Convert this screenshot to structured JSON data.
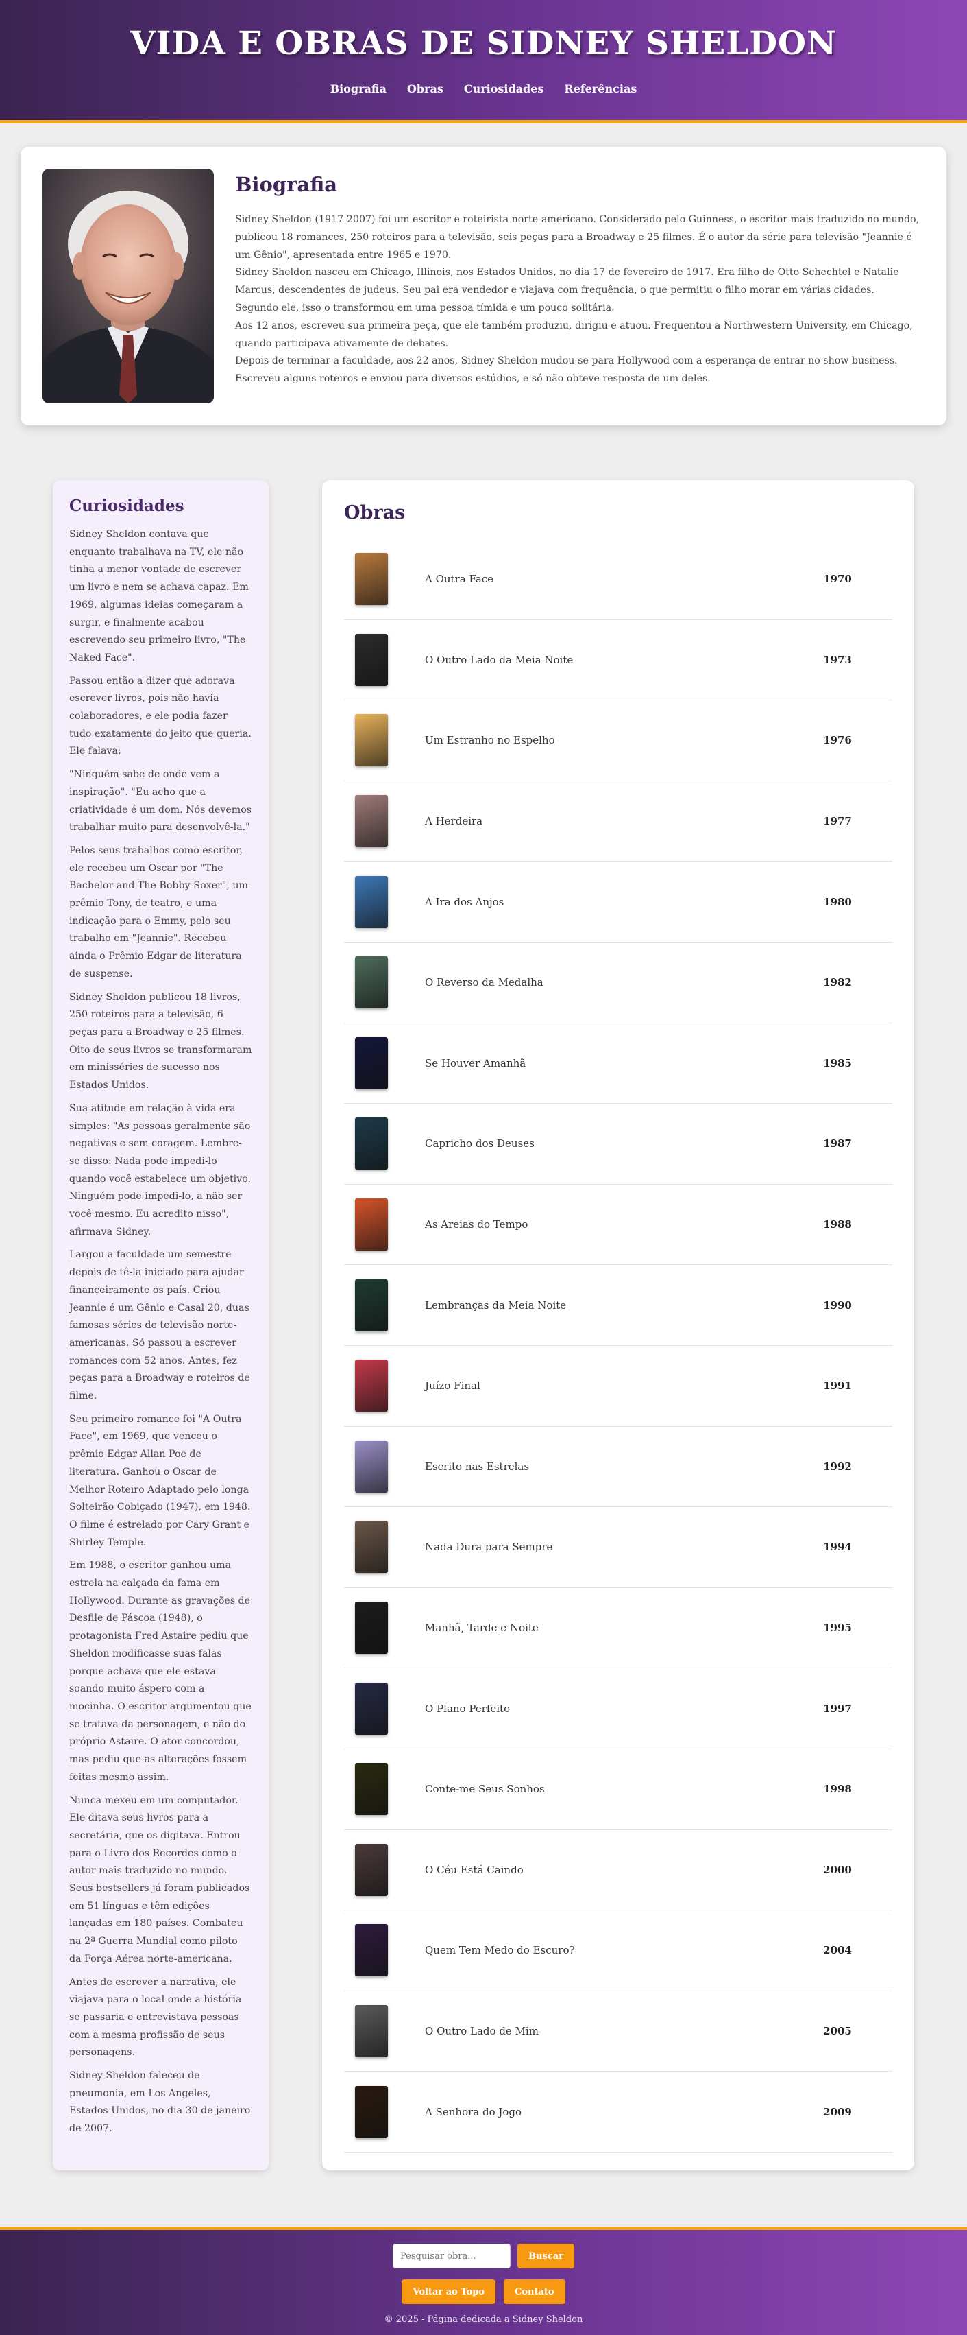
{
  "header": {
    "title": "VIDA E OBRAS DE SIDNEY SHELDON",
    "nav": [
      "Biografia",
      "Obras",
      "Curiosidades",
      "Referências"
    ]
  },
  "biography": {
    "title": "Biografia",
    "portrait_alt": "Sidney Sheldon",
    "paragraphs": [
      "Sidney Sheldon (1917-2007) foi um escritor e roteirista norte-americano. Considerado pelo Guinness, o escritor mais traduzido no mundo, publicou 18 romances, 250 roteiros para a televisão, seis peças para a Broadway e 25 filmes. É o autor da série para televisão \"Jeannie é um Gênio\", apresentada entre 1965 e 1970.",
      "Sidney Sheldon nasceu em Chicago, Illinois, nos Estados Unidos, no dia 17 de fevereiro de 1917. Era filho de Otto Schechtel e Natalie Marcus, descendentes de judeus. Seu pai era vendedor e viajava com frequência, o que permitiu o filho morar em várias cidades. Segundo ele, isso o transformou em uma pessoa tímida e um pouco solitária.",
      "Aos 12 anos, escreveu sua primeira peça, que ele também produziu, dirigiu e atuou. Frequentou a Northwestern University, em Chicago, quando participava ativamente de debates.",
      "Depois de terminar a faculdade, aos 22 anos, Sidney Sheldon mudou-se para Hollywood com a esperança de entrar no show business. Escreveu alguns roteiros e enviou para diversos estúdios, e só não obteve resposta de um deles."
    ]
  },
  "curiosities": {
    "title": "Curiosidades",
    "paragraphs": [
      "Sidney Sheldon contava que enquanto trabalhava na TV, ele não tinha a menor vontade de escrever um livro e nem se achava capaz. Em 1969, algumas ideias começaram a surgir, e finalmente acabou escrevendo seu primeiro livro, \"The Naked Face\".",
      "Passou então a dizer que adorava escrever livros, pois não havia colaboradores, e ele podia fazer tudo exatamente do jeito que queria. Ele falava:",
      "\"Ninguém sabe de onde vem a inspiração\". \"Eu acho que a criatividade é um dom. Nós devemos trabalhar muito para desenvolvê-la.\"",
      "Pelos seus trabalhos como escritor, ele recebeu um Oscar por \"The Bachelor and The Bobby-Soxer\", um prêmio Tony, de teatro, e uma indicação para o Emmy, pelo seu trabalho em \"Jeannie\". Recebeu ainda o Prêmio Edgar de literatura de suspense.",
      "Sidney Sheldon publicou 18 livros, 250 roteiros para a televisão, 6 peças para a Broadway e 25 filmes. Oito de seus livros se transformaram em minisséries de sucesso nos Estados Unidos.",
      "Sua atitude em relação à vida era simples: \"As pessoas geralmente são negativas e sem coragem. Lembre-se disso: Nada pode impedi-lo quando você estabelece um objetivo. Ninguém pode impedi-lo, a não ser você mesmo. Eu acredito nisso\", afirmava Sidney.",
      "Largou a faculdade um semestre depois de tê-la iniciado para ajudar financeiramente os país. Criou Jeannie é um Gênio e Casal 20, duas famosas séries de televisão norte-americanas. Só passou a escrever romances com 52 anos. Antes, fez peças para a Broadway e roteiros de filme.",
      "Seu primeiro romance foi \"A Outra Face\", em 1969, que venceu o prêmio Edgar Allan Poe de literatura. Ganhou o Oscar de Melhor Roteiro Adaptado pelo longa Solteirão Cobiçado (1947), em 1948. O filme é estrelado por Cary Grant e Shirley Temple.",
      "Em 1988, o escritor ganhou uma estrela na calçada da fama em Hollywood. Durante as gravações de Desfile de Páscoa (1948), o protagonista Fred Astaire pediu que Sheldon modificasse suas falas porque achava que ele estava soando muito áspero com a mocinha. O escritor argumentou que se tratava da personagem, e não do próprio Astaire. O ator concordou, mas pediu que as alterações fossem feitas mesmo assim.",
      "Nunca mexeu em um computador. Ele ditava seus livros para a secretária, que os digitava. Entrou para o Livro dos Recordes como o autor mais traduzido no mundo. Seus bestsellers já foram publicados em 51 línguas e têm edições lançadas em 180 países. Combateu na 2ª Guerra Mundial como piloto da Força Aérea norte-americana.",
      "Antes de escrever a narrativa, ele viajava para o local onde a história se passaria e entrevistava pessoas com a mesma profissão de seus personagens.",
      "Sidney Sheldon faleceu de pneumonia, em Los Angeles, Estados Unidos, no dia 30 de janeiro de 2007."
    ]
  },
  "works": {
    "title": "Obras",
    "items": [
      {
        "title": "A Outra Face",
        "year": "1970",
        "cover_color": "#b87a3e"
      },
      {
        "title": "O Outro Lado da Meia Noite",
        "year": "1973",
        "cover_color": "#2b2b2b"
      },
      {
        "title": "Um Estranho no Espelho",
        "year": "1976",
        "cover_color": "#e7b25a"
      },
      {
        "title": "A Herdeira",
        "year": "1977",
        "cover_color": "#a07b7a"
      },
      {
        "title": "A Ira dos Anjos",
        "year": "1980",
        "cover_color": "#3d77b5"
      },
      {
        "title": "O Reverso da Medalha",
        "year": "1982",
        "cover_color": "#4d6b5a"
      },
      {
        "title": "Se Houver Amanhã",
        "year": "1985",
        "cover_color": "#15163a"
      },
      {
        "title": "Capricho dos Deuses",
        "year": "1987",
        "cover_color": "#1d3a4a"
      },
      {
        "title": "As Areias do Tempo",
        "year": "1988",
        "cover_color": "#d5542a"
      },
      {
        "title": "Lembranças da Meia Noite",
        "year": "1990",
        "cover_color": "#1f3b33"
      },
      {
        "title": "Juízo Final",
        "year": "1991",
        "cover_color": "#c33a4a"
      },
      {
        "title": "Escrito nas Estrelas",
        "year": "1992",
        "cover_color": "#9a8fc7"
      },
      {
        "title": "Nada Dura para Sempre",
        "year": "1994",
        "cover_color": "#6a5648"
      },
      {
        "title": "Manhã, Tarde e Noite",
        "year": "1995",
        "cover_color": "#1b1b1b"
      },
      {
        "title": "O Plano Perfeito",
        "year": "1997",
        "cover_color": "#262a44"
      },
      {
        "title": "Conte-me Seus Sonhos",
        "year": "1998",
        "cover_color": "#2a2a10"
      },
      {
        "title": "O Céu Está Caindo",
        "year": "2000",
        "cover_color": "#4a3a3a"
      },
      {
        "title": "Quem Tem Medo do Escuro?",
        "year": "2004",
        "cover_color": "#2d1b3d"
      },
      {
        "title": "O Outro Lado de Mim",
        "year": "2005",
        "cover_color": "#5a5a5a"
      },
      {
        "title": "A Senhora do Jogo",
        "year": "2009",
        "cover_color": "#2a1a10"
      }
    ]
  },
  "footer": {
    "search_placeholder": "Pesquisar obra...",
    "search_button": "Buscar",
    "back_to_top": "Voltar ao Topo",
    "contact": "Contato",
    "copyright": "© 2025 - Página dedicada a Sidney Sheldon"
  },
  "colors": {
    "header_purple": "#6a3592",
    "accent_orange": "#f79a12",
    "title_purple": "#3d2456"
  }
}
